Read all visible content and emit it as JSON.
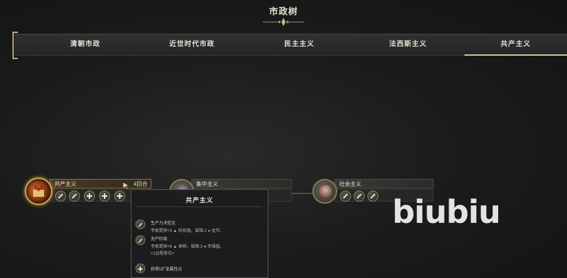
{
  "header": {
    "title": "市政树"
  },
  "tabs": [
    {
      "label": "清朝市政",
      "active": false
    },
    {
      "label": "近世时代市政",
      "active": false
    },
    {
      "label": "民主主义",
      "active": false
    },
    {
      "label": "法西斯主义",
      "active": false
    },
    {
      "label": "共产主义",
      "active": true
    }
  ],
  "tree": {
    "nodes": [
      {
        "name": "共产主义",
        "turns": "4回合",
        "state": "active"
      },
      {
        "name": "集中主义",
        "turns": "",
        "state": "locked"
      },
      {
        "name": "社会主义",
        "turns": "",
        "state": "locked"
      }
    ]
  },
  "tooltip": {
    "title": "共产主义",
    "rows": [
      {
        "name": "生产力决定论",
        "desc": "专家提供+3 ▲ 科技值，城镇-2 ● 金币。",
        "desc2": ""
      },
      {
        "name": "无产阶级",
        "desc": "专家提供+6 ▲ 食物，城镇-3 ● 幸福值。",
        "desc2": "<1远程单位>"
      },
      {
        "name": "获得1扩张属性点",
        "desc": "",
        "desc2": ""
      }
    ]
  },
  "watermark": "biubiu",
  "colors": {
    "accent": "#d7c69b",
    "active_glow": "#c89b42",
    "background": "#1b1c1c"
  },
  "icons": [
    "title-ornament-icon",
    "tech-slot-icon",
    "plus-slot-icon"
  ]
}
